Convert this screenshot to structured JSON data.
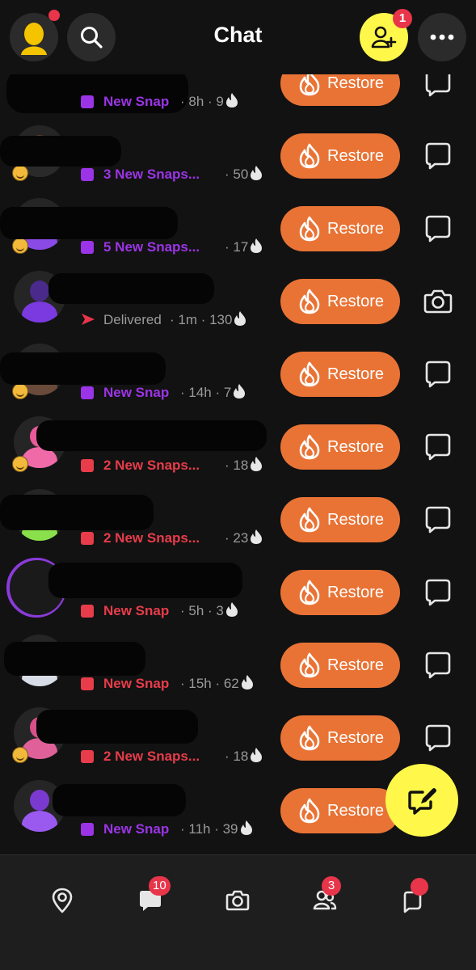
{
  "header": {
    "title": "Chat",
    "add_friends_badge": "1",
    "icons": [
      "avatar-icon",
      "search-icon",
      "add-friend-icon",
      "more-icon"
    ]
  },
  "colors": {
    "background": "#121212",
    "restore_button": "#e97335",
    "purple_status": "#9b34e6",
    "red_status": "#e83c4a",
    "accent_yellow": "#fff84a",
    "badge_red": "#e8354a"
  },
  "chats": [
    {
      "status": "New Snap",
      "status_type": "purple",
      "meta": "· 8h · 9",
      "action_icon": "chat-icon",
      "restore_label": "Restore"
    },
    {
      "status": "3 New Snaps...",
      "status_type": "purple",
      "meta": "· 50",
      "action_icon": "chat-icon",
      "restore_label": "Restore"
    },
    {
      "status": "5 New Snaps...",
      "status_type": "purple",
      "meta": "· 17",
      "action_icon": "chat-icon",
      "restore_label": "Restore"
    },
    {
      "status": "Delivered",
      "status_type": "delivered",
      "meta": "· 1m · 130",
      "action_icon": "camera-icon",
      "restore_label": "Restore"
    },
    {
      "status": "New Snap",
      "status_type": "purple",
      "meta": "· 14h · 7",
      "action_icon": "chat-icon",
      "restore_label": "Restore"
    },
    {
      "status": "2 New Snaps...",
      "status_type": "red",
      "meta": "· 18",
      "action_icon": "chat-icon",
      "restore_label": "Restore"
    },
    {
      "status": "2 New Snaps...",
      "status_type": "red",
      "meta": "· 23",
      "action_icon": "chat-icon",
      "restore_label": "Restore"
    },
    {
      "status": "New Snap",
      "status_type": "red",
      "meta": "· 5h · 3",
      "action_icon": "chat-icon",
      "restore_label": "Restore"
    },
    {
      "status": "New Snap",
      "status_type": "red",
      "meta": "· 15h · 62",
      "action_icon": "chat-icon",
      "restore_label": "Restore"
    },
    {
      "status": "2 New Snaps...",
      "status_type": "red",
      "meta": "· 18",
      "action_icon": "chat-icon",
      "restore_label": "Restore"
    },
    {
      "status": "New Snap",
      "status_type": "purple",
      "meta": "· 11h · 39",
      "action_icon": "none",
      "restore_label": "Restore"
    }
  ],
  "fab": {
    "icon": "compose-icon"
  },
  "bottom_nav": [
    {
      "name": "map",
      "icon": "map-pin-icon",
      "badge": ""
    },
    {
      "name": "chat",
      "icon": "chat-icon",
      "badge": "10"
    },
    {
      "name": "camera",
      "icon": "camera-icon",
      "badge": ""
    },
    {
      "name": "stories",
      "icon": "friends-icon",
      "badge": "3"
    },
    {
      "name": "spotlight",
      "icon": "spotlight-icon",
      "badge": ""
    }
  ]
}
